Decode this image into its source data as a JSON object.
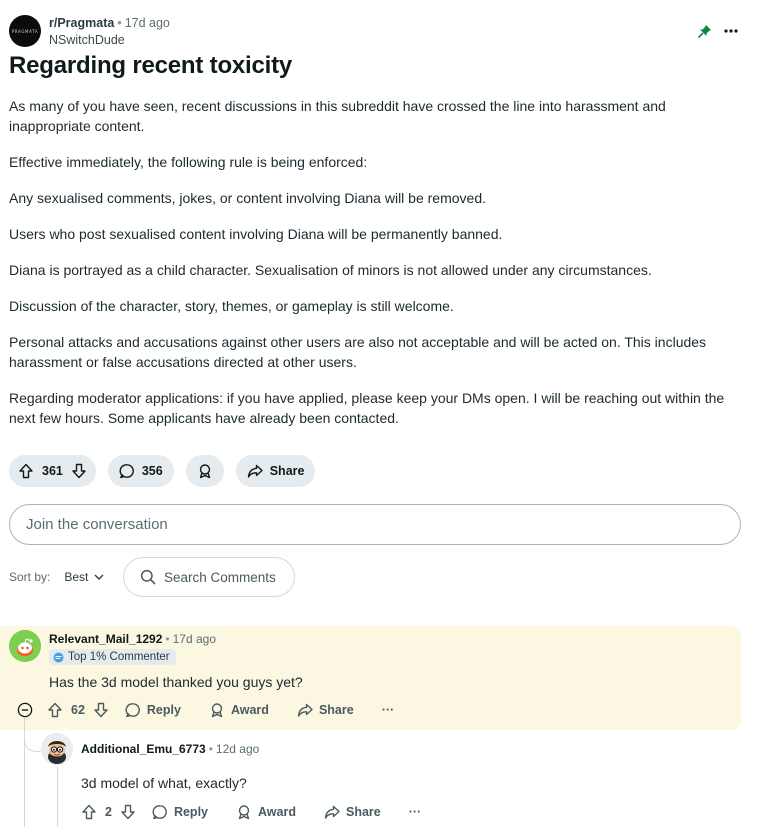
{
  "post": {
    "subreddit": "r/Pragmata",
    "subreddit_avatar_text": "PRAGMATA",
    "time_ago": "17d ago",
    "author": "NSwitchDude",
    "title": "Regarding recent toxicity",
    "paragraphs": [
      "As many of you have seen, recent discussions in this subreddit have crossed the line into harassment and inappropriate content.",
      "Effective immediately, the following rule is being enforced:",
      "Any sexualised comments, jokes, or content involving Diana will be removed.",
      "Users who post sexualised content involving Diana will be permanently banned.",
      "Diana is portrayed as a child character. Sexualisation of minors is not allowed under any circumstances.",
      "Discussion of the character, story, themes, or gameplay is still welcome.",
      "Personal attacks and accusations against other users are also not acceptable and will be acted on. This includes harassment or false accusations directed at other users.",
      "Regarding moderator applications: if you have applied, please keep your DMs open. I will be reaching out within the next few hours. Some applicants have already been contacted."
    ],
    "votes": "361",
    "comments": "356",
    "share_label": "Share"
  },
  "join_placeholder": "Join the conversation",
  "sort": {
    "label": "Sort by:",
    "value": "Best"
  },
  "search_placeholder": "Search Comments",
  "comments": [
    {
      "user": "Relevant_Mail_1292",
      "time_ago": "17d ago",
      "badge": "Top 1% Commenter",
      "text": "Has the 3d model thanked you guys yet?",
      "votes": "62",
      "reply_label": "Reply",
      "award_label": "Award",
      "share_label": "Share",
      "more_label": "···"
    },
    {
      "user": "Additional_Emu_6773",
      "time_ago": "12d ago",
      "text": "3d model of what, exactly?",
      "votes": "2",
      "reply_label": "Reply",
      "award_label": "Award",
      "share_label": "Share",
      "more_label": "···"
    }
  ],
  "colors": {
    "highlight_bg": "#fcf7e1",
    "pill_bg": "#e5ebee",
    "pin_green": "#0b8a3a",
    "avatar_green": "#7ccf50"
  },
  "icons": [
    "pin-icon",
    "more-icon",
    "upvote-icon",
    "downvote-icon",
    "comment-icon",
    "award-icon",
    "share-icon",
    "search-icon",
    "chevron-down-icon",
    "collapse-icon",
    "reply-icon"
  ]
}
